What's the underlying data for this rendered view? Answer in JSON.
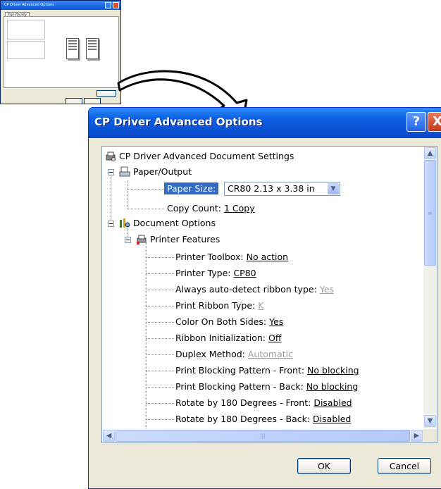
{
  "thumbnail": {
    "title": "CP Driver Advanced Options",
    "tab": "Paper/Quality"
  },
  "dialog": {
    "title": "CP Driver Advanced Options",
    "help_glyph": "?",
    "close_glyph": "X"
  },
  "tree": {
    "root": "CP Driver Advanced Document Settings",
    "paper_output": "Paper/Output",
    "paper_size_label": "Paper Size:",
    "paper_size_value": "CR80 2.13 x 3.38 in",
    "copy_count_label": "Copy Count: ",
    "copy_count_value": "1 Copy",
    "document_options": "Document Options",
    "printer_features": "Printer Features",
    "features": [
      {
        "label": "Printer Toolbox: ",
        "value": "No action",
        "disabled": false
      },
      {
        "label": "Printer Type: ",
        "value": "CP80",
        "disabled": false
      },
      {
        "label": "Always auto-detect ribbon type: ",
        "value": "Yes",
        "disabled": true
      },
      {
        "label": "Print Ribbon Type: ",
        "value": "K",
        "disabled": true
      },
      {
        "label": "Color On Both Sides: ",
        "value": "Yes",
        "disabled": false
      },
      {
        "label": "Ribbon Initialization: ",
        "value": "Off",
        "disabled": false
      },
      {
        "label": "Duplex Method: ",
        "value": "Automatic",
        "disabled": true
      },
      {
        "label": "Print Blocking Pattern - Front: ",
        "value": "No blocking",
        "disabled": false
      },
      {
        "label": "Print Blocking Pattern - Back: ",
        "value": "No blocking",
        "disabled": false
      },
      {
        "label": "Rotate by 180 Degrees - Front: ",
        "value": "Disabled",
        "disabled": false
      },
      {
        "label": "Rotate by 180 Degrees - Back: ",
        "value": "Disabled",
        "disabled": false
      }
    ]
  },
  "buttons": {
    "ok": "OK",
    "cancel": "Cancel"
  },
  "icons": {
    "scroll_up": "chevron-up-icon",
    "scroll_down": "chevron-down-icon",
    "scroll_left": "chevron-left-icon",
    "scroll_right": "chevron-right-icon"
  }
}
